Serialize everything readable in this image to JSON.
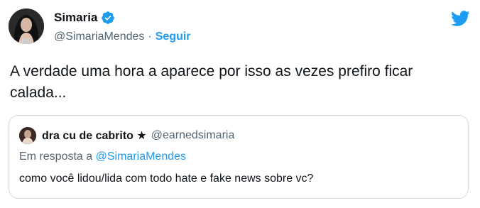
{
  "author": {
    "name": "Simaria",
    "handle": "@SimariaMendes",
    "separator": "·",
    "follow_label": "Seguir",
    "verified_icon": "verified-badge-icon",
    "brand_icon": "twitter-bird-icon"
  },
  "tweet": {
    "text": "A verdade uma hora a aparece por isso as vezes prefiro ficar calada..."
  },
  "quote": {
    "name": "dra cu de cabrito ★",
    "handle": "@earnedsimaria",
    "reply_prefix": "Em resposta a",
    "reply_mention": "@SimariaMendes",
    "text": "como você lidou/lida com todo hate e fake news sobre vc?"
  },
  "colors": {
    "accent": "#1d9bf0",
    "text": "#0f1419",
    "secondary": "#536471",
    "border": "#cfd9de"
  }
}
